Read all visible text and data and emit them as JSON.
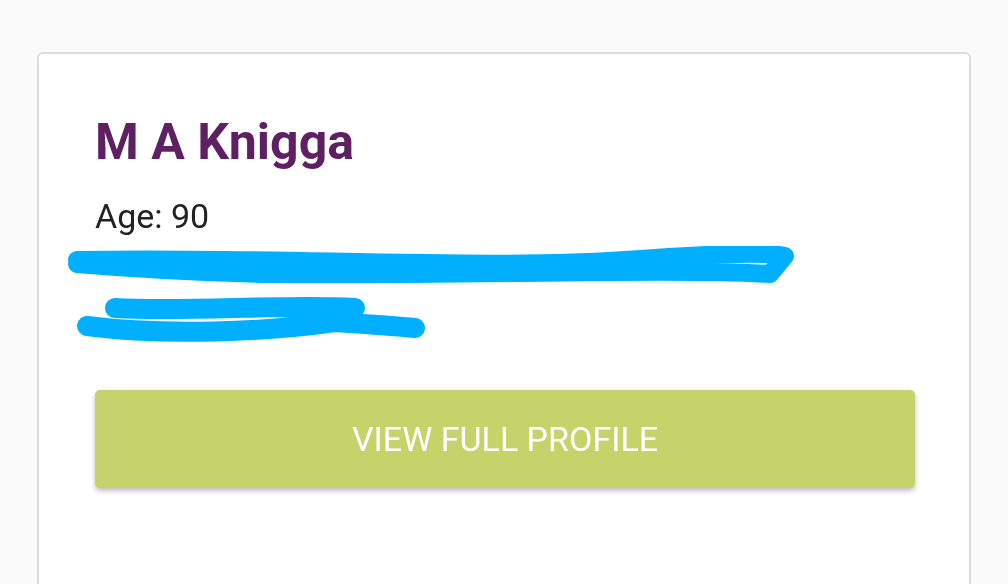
{
  "card": {
    "name": "M A Knigga",
    "age": "Age: 90",
    "button": "VIEW FULL PROFILE"
  }
}
